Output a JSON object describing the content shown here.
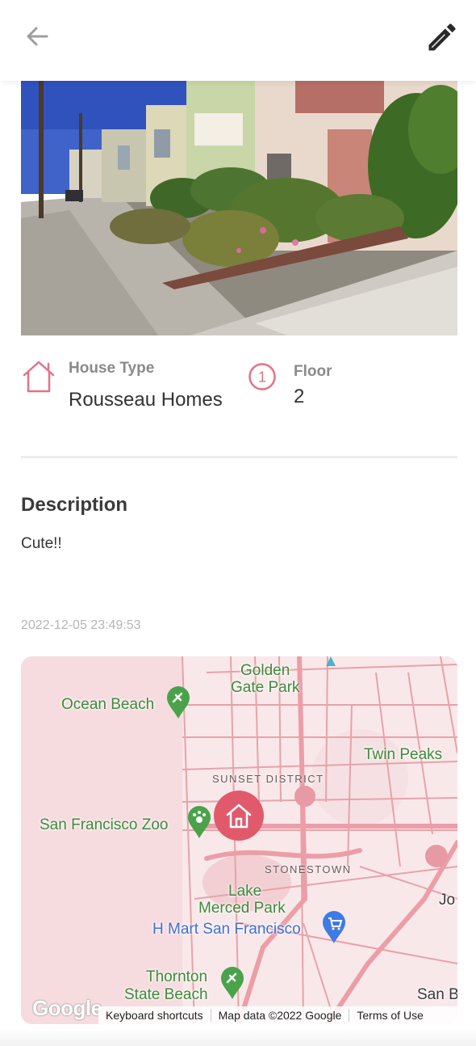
{
  "header": {
    "back_icon": "arrow-left-icon",
    "edit_icon": "pencil-icon"
  },
  "details": {
    "house_type_label": "House Type",
    "house_type_value": "Rousseau Homes",
    "floor_label": "Floor",
    "floor_value": "2",
    "floor_badge": "1"
  },
  "description": {
    "title": "Description",
    "text": "Cute!!"
  },
  "timestamp": "2022-12-05 23:49:53",
  "map": {
    "places": {
      "golden_gate_park_line1": "Golden",
      "golden_gate_park_line2": "Gate Park",
      "ocean_beach": "Ocean Beach",
      "twin_peaks": "Twin Peaks",
      "sunset_district": "SUNSET DISTRICT",
      "sf_zoo": "San Francisco Zoo",
      "stonestown": "STONESTOWN",
      "lake_merced_line1": "Lake",
      "lake_merced_line2": "Merced Park",
      "h_mart": "H Mart San Francisco",
      "thornton_line1": "Thornton",
      "thornton_line2": "State Beach",
      "san_bruno_partial": "San B",
      "jo_partial": "Jo"
    },
    "footer": {
      "shortcuts": "Keyboard shortcuts",
      "map_data": "Map data ©2022 Google",
      "terms": "Terms of Use"
    },
    "logo_text": "Google",
    "colors": {
      "accent": "#e15a6c",
      "park_green": "#4aa34a",
      "shopping_blue": "#3e7be6"
    }
  },
  "colors": {
    "accent_pink": "#e37385",
    "label_gray": "#8a8a8a"
  }
}
